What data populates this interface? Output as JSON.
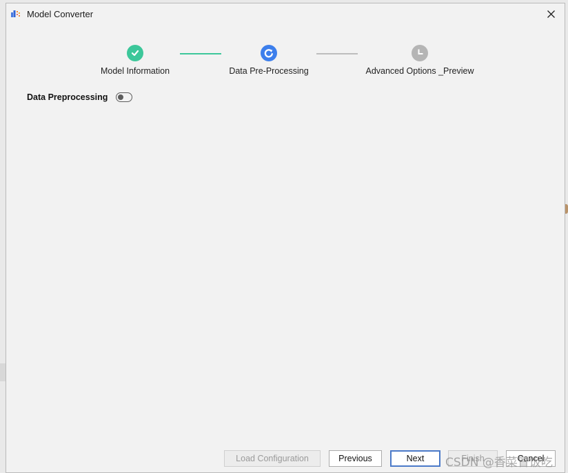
{
  "window": {
    "title": "Model Converter",
    "icons": {
      "app": "model-converter-app-icon",
      "close": "close-icon"
    }
  },
  "stepper": {
    "steps": [
      {
        "label": "Model Information",
        "status": "completed",
        "color": "#3cc79a",
        "icon": "check-icon"
      },
      {
        "label": "Data Pre-Processing",
        "status": "in-progress",
        "color": "#3d7fec",
        "icon": "refresh-icon"
      },
      {
        "label": "Advanced Options _Preview",
        "status": "pending",
        "color": "#b5b5b5",
        "icon": "clock-icon"
      }
    ],
    "connectors": [
      {
        "status": "completed",
        "color": "#3cc79a"
      },
      {
        "status": "pending",
        "color": "#bdbdbd"
      }
    ]
  },
  "preprocessing": {
    "label": "Data Preprocessing",
    "enabled": false
  },
  "footer": {
    "load_configuration": "Load Configuration",
    "previous": "Previous",
    "next": "Next",
    "finish": "Finish",
    "cancel": "Cancel"
  },
  "watermark": "CSDN @香菜冒饭吃"
}
